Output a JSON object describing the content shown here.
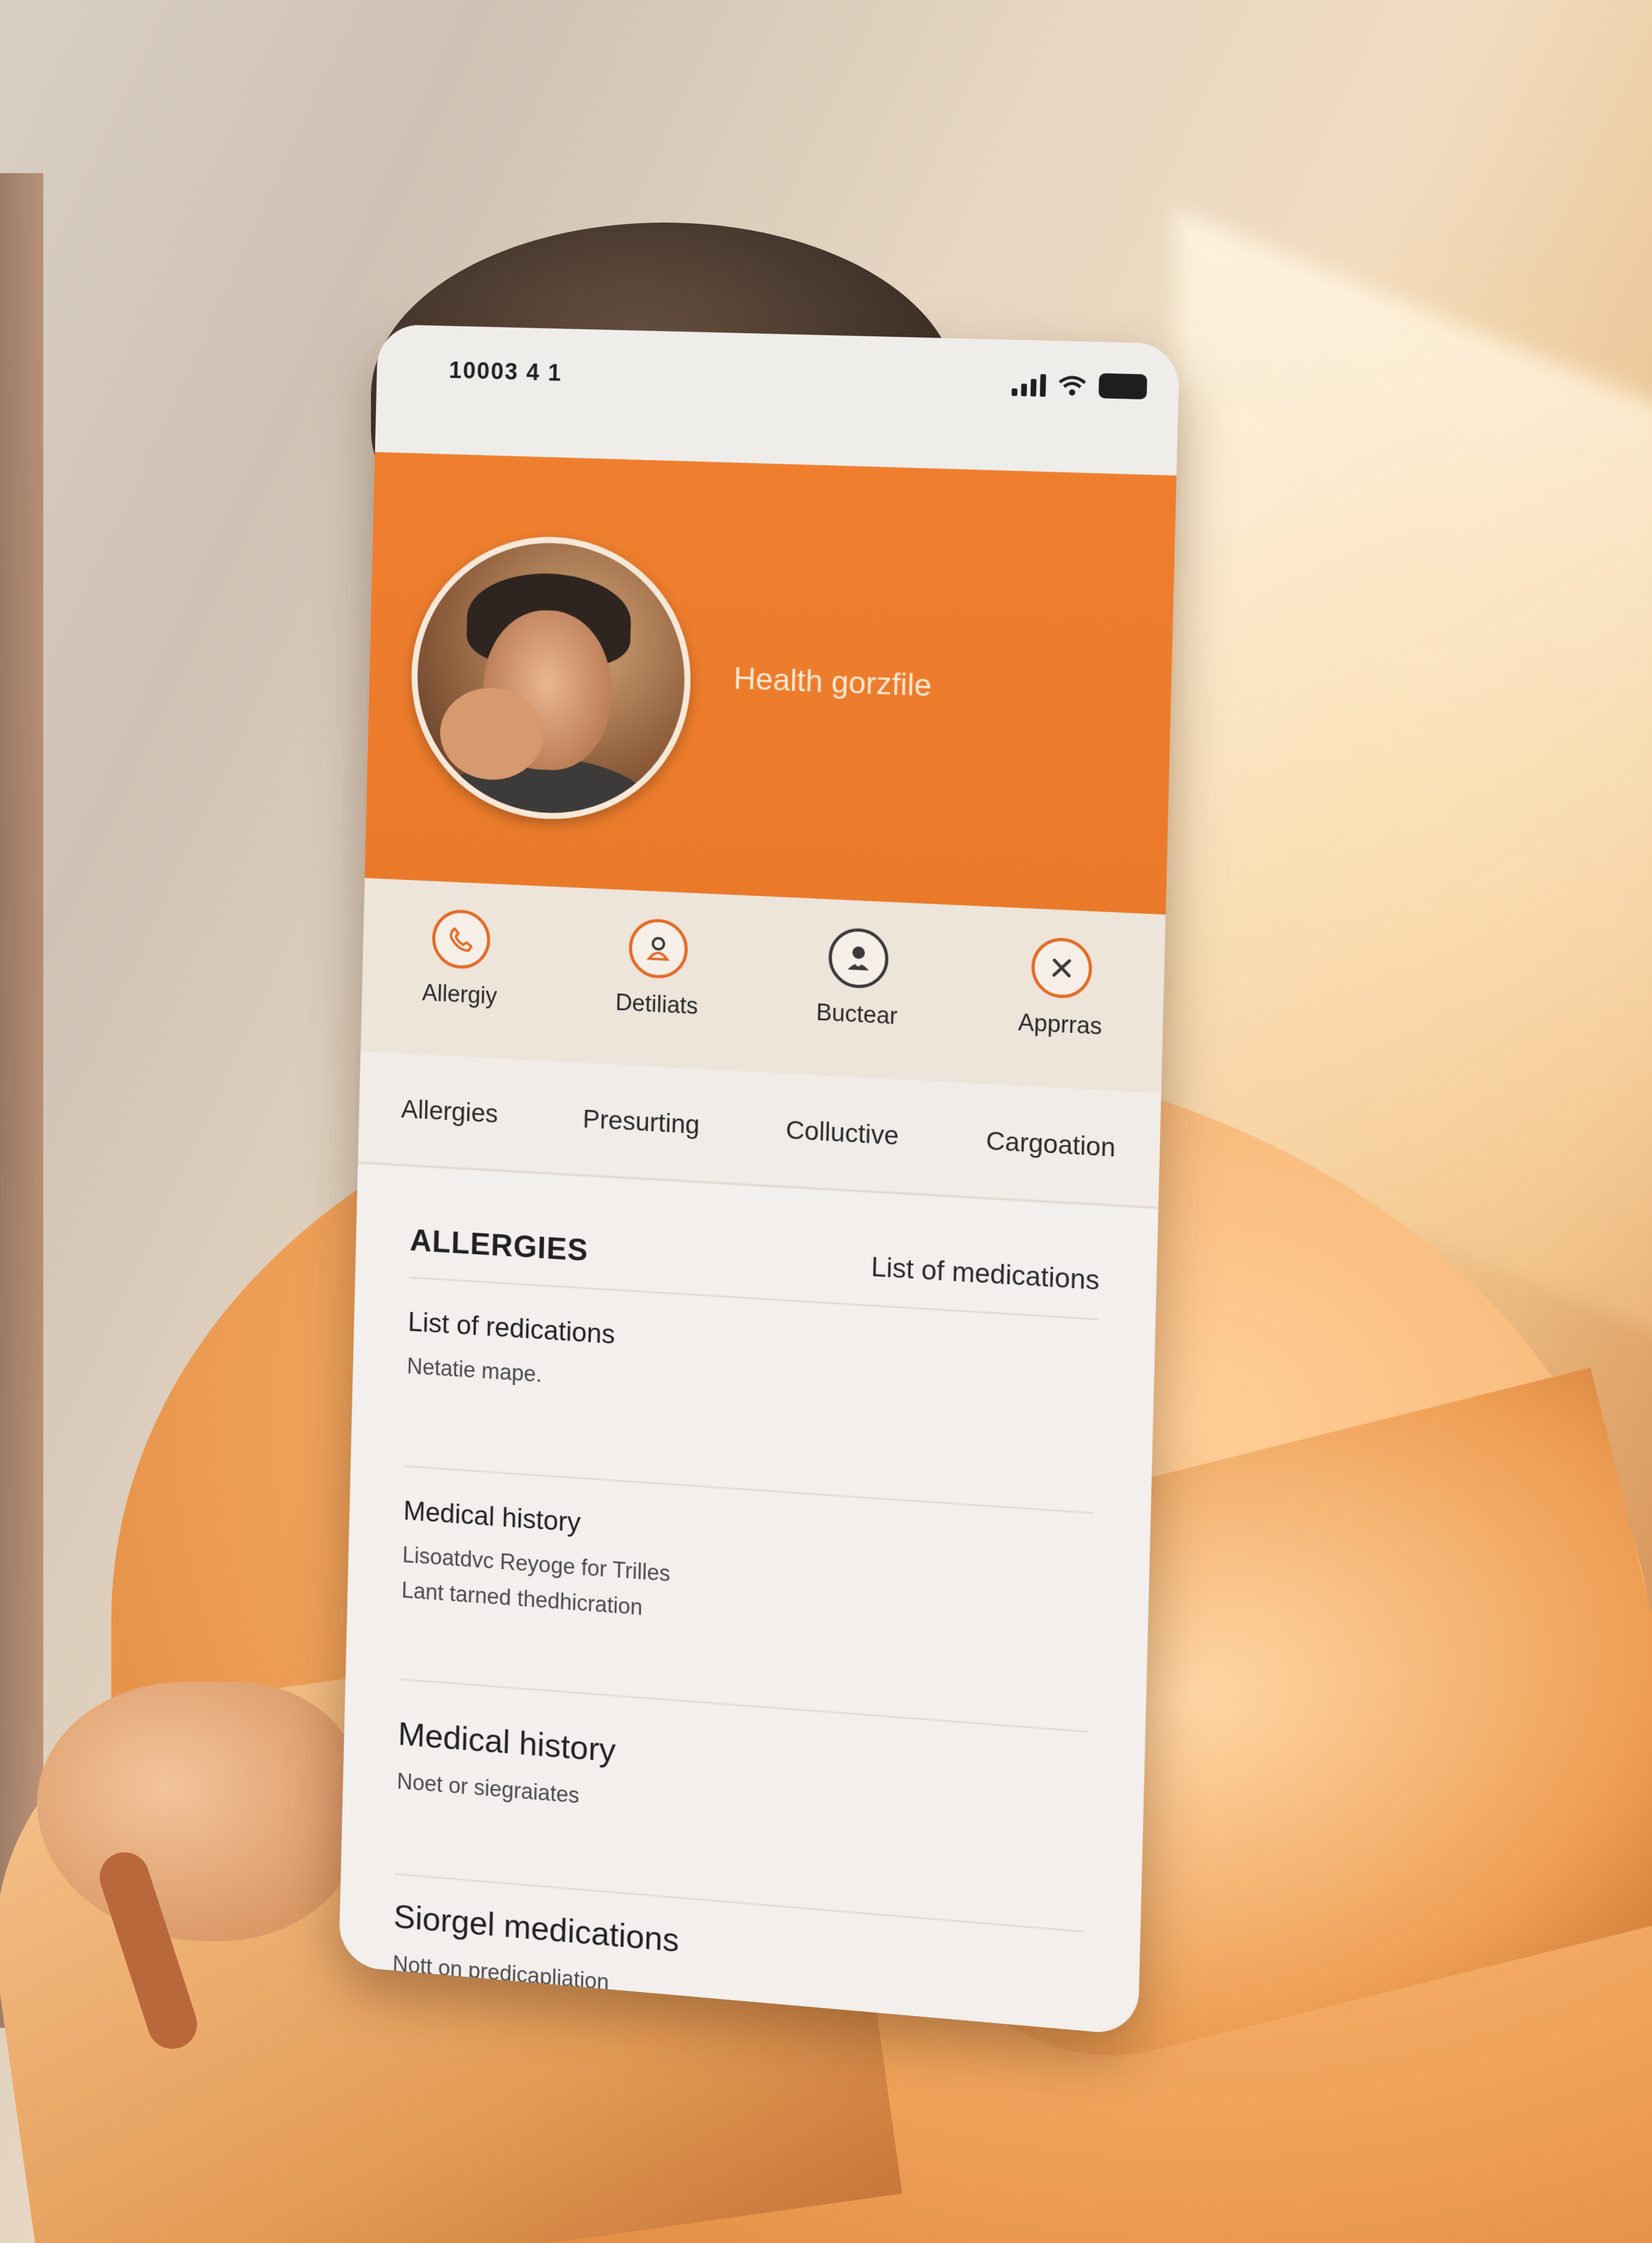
{
  "status_bar": {
    "time": "10003 4 1"
  },
  "profile": {
    "title": "Health gorzfile"
  },
  "quick_actions": [
    {
      "label": "Allergiy",
      "icon": "phone-icon"
    },
    {
      "label": "Detiliats",
      "icon": "person-icon"
    },
    {
      "label": "Buctear",
      "icon": "doctor-icon"
    },
    {
      "label": "Apprras",
      "icon": "close-icon"
    }
  ],
  "tabs": [
    "Allergies",
    "Presurting",
    "Colluctive",
    "Cargoation"
  ],
  "section": {
    "title": "ALLERGIES",
    "link": "List of medications"
  },
  "items": [
    {
      "title": "List of redications",
      "lines": [
        "Netatie mape."
      ]
    },
    {
      "title": "Medical history",
      "lines": [
        "Lisoatdvc Reyoge for Trilles",
        "Lant tarned thedhicration"
      ]
    },
    {
      "title": "Medical history",
      "lines": [
        "Noet or siegraiates"
      ]
    },
    {
      "title": "Siorgel medications",
      "lines": [
        "Nott on predicapliation"
      ]
    }
  ],
  "colors": {
    "accent": "#EA7A2A",
    "header_text": "#FDE7CF"
  }
}
